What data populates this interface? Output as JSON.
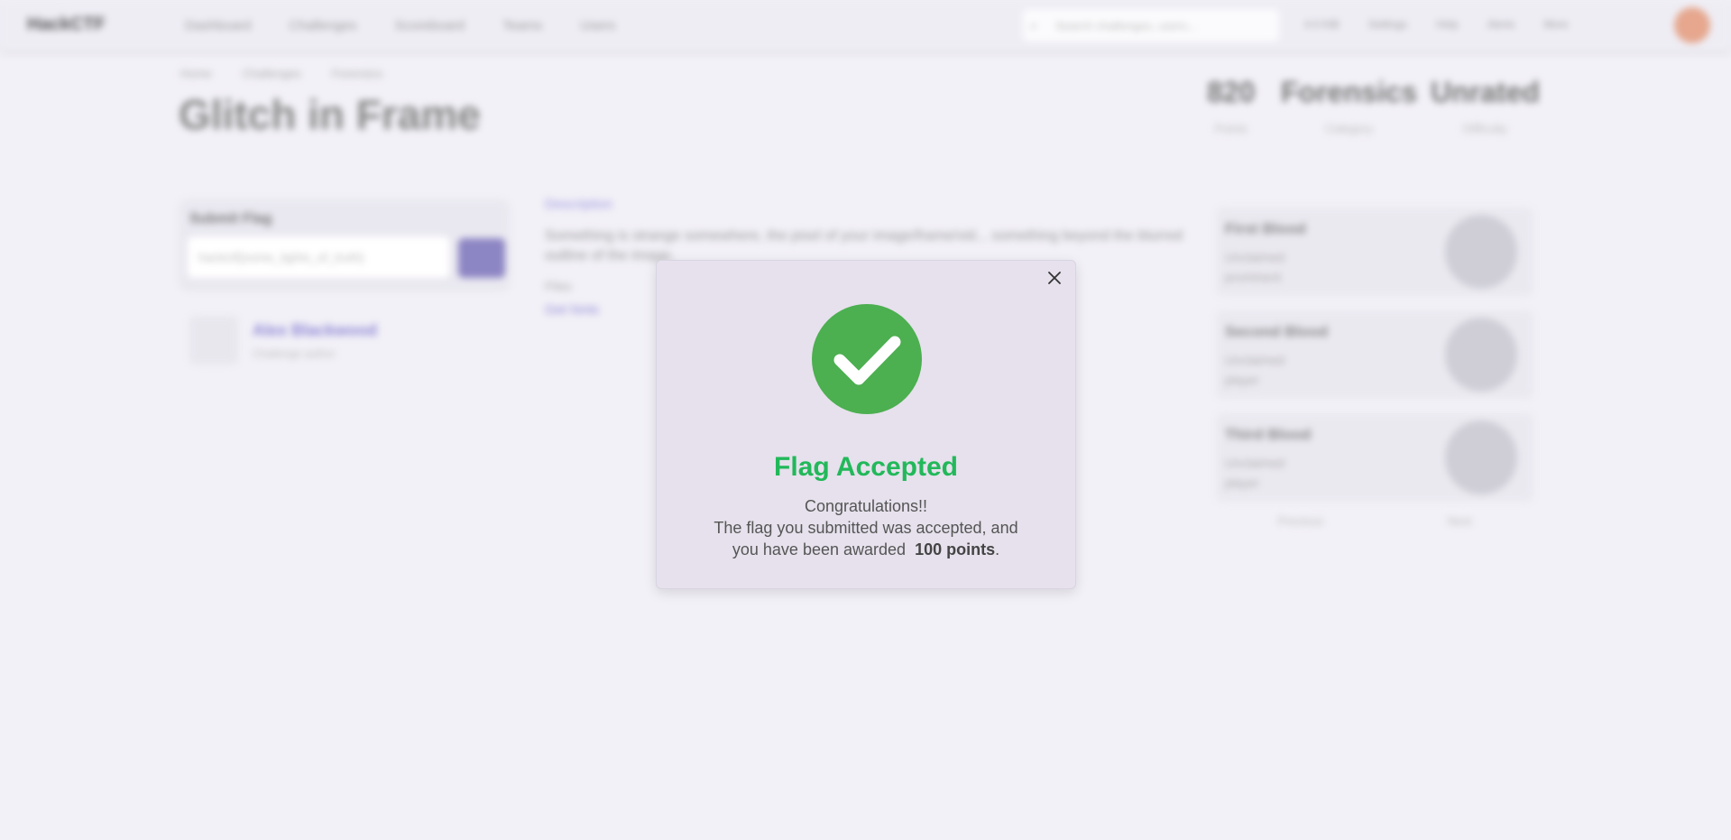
{
  "background": {
    "brand": "HackCTF",
    "nav": [
      "Dashboard",
      "Challenges",
      "Scoreboard",
      "Teams",
      "Users"
    ],
    "search_placeholder": "Search challenges, users...",
    "tools": [
      "4.0 KiB",
      "Settings",
      "Help",
      "Alerts",
      "More"
    ],
    "breadcrumb": [
      "Home",
      "Challenges",
      "Forensics"
    ],
    "challenge_title": "Glitch in Frame",
    "stats": [
      {
        "value": "820",
        "label": "Points"
      },
      {
        "value": "Forensics",
        "label": "Category"
      },
      {
        "value": "Unrated",
        "label": "Difficulty"
      }
    ],
    "submit_label": "Submit Flag",
    "flag_placeholder": "hackctf{some_lights_of_truth}",
    "author_name": "Alex Blackwood",
    "author_sub": "Challenge author",
    "desc_heading": "Description",
    "desc_text": "Something is strange somewhere, the pixel of your image/frame/vid... something beyond the blurred outline of the image.",
    "attachment": "Files",
    "hint_link": "Get hints",
    "medals": [
      {
        "title": "First Blood",
        "sub": "Unclaimed\nprominent"
      },
      {
        "title": "Second Blood",
        "sub": "Unclaimed\nplayer"
      },
      {
        "title": "Third Blood",
        "sub": "Unclaimed\nplayer"
      }
    ],
    "pager_prev": "Previous",
    "pager_next": "Next"
  },
  "modal": {
    "title": "Flag Accepted",
    "line1": "Congratulations!!",
    "line2_a": "The flag you submitted was accepted, and",
    "line2_b": "you have been awarded",
    "points": "100 points",
    "period": ".",
    "close_icon": "close-icon",
    "success_icon": "check-circle-icon",
    "success_color": "#4caf50",
    "title_color": "#22b85a"
  }
}
